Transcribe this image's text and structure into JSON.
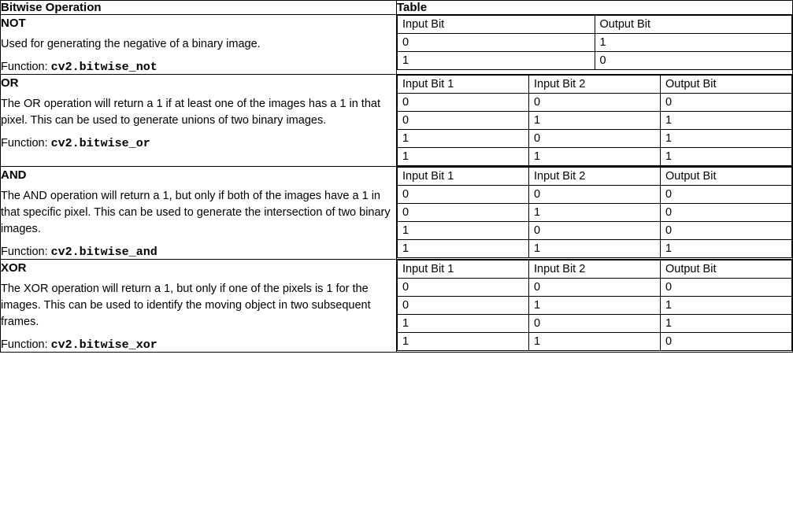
{
  "headers": {
    "operation": "Bitwise Operation",
    "table": "Table"
  },
  "function_prefix": "Function: ",
  "ops": {
    "not": {
      "title": "NOT",
      "desc": "Used for generating the negative of a binary image.",
      "func": "cv2.bitwise_not",
      "cols": [
        "Input Bit",
        "Output Bit"
      ],
      "rows": [
        [
          "0",
          "1"
        ],
        [
          "1",
          "0"
        ]
      ]
    },
    "or": {
      "title": "OR",
      "desc": "The OR operation will return a 1 if at least one of the images has a 1 in that pixel. This can be used to generate unions of two binary images.",
      "func": "cv2.bitwise_or",
      "cols": [
        "Input Bit 1",
        "Input Bit 2",
        "Output Bit"
      ],
      "rows": [
        [
          "0",
          "0",
          "0"
        ],
        [
          "0",
          "1",
          "1"
        ],
        [
          "1",
          "0",
          "1"
        ],
        [
          "1",
          "1",
          "1"
        ]
      ]
    },
    "and": {
      "title": "AND",
      "desc": "The AND operation will return a 1, but only if both of the images have a 1 in that specific pixel. This can be used to generate the intersection of two binary images.",
      "func": "cv2.bitwise_and",
      "cols": [
        "Input Bit 1",
        "Input Bit 2",
        "Output Bit"
      ],
      "rows": [
        [
          "0",
          "0",
          "0"
        ],
        [
          "0",
          "1",
          "0"
        ],
        [
          "1",
          "0",
          "0"
        ],
        [
          "1",
          "1",
          "1"
        ]
      ]
    },
    "xor": {
      "title": "XOR",
      "desc": "The XOR operation will return a 1, but only if one of the pixels is 1 for the images. This can be used to identify the moving object in two subsequent frames.",
      "func": "cv2.bitwise_xor",
      "cols": [
        "Input Bit 1",
        "Input Bit 2",
        "Output Bit"
      ],
      "rows": [
        [
          "0",
          "0",
          "0"
        ],
        [
          "0",
          "1",
          "1"
        ],
        [
          "1",
          "0",
          "1"
        ],
        [
          "1",
          "1",
          "0"
        ]
      ]
    }
  }
}
